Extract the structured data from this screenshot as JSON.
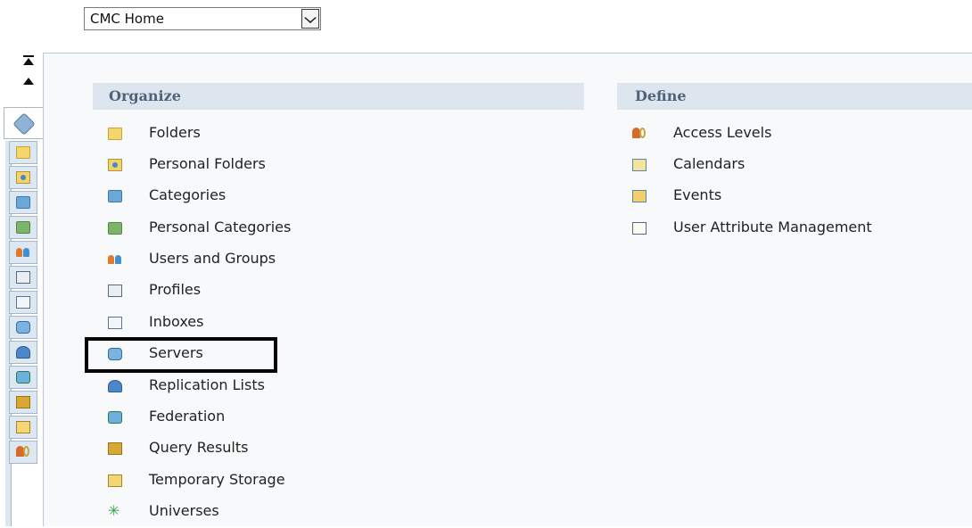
{
  "nav": {
    "selected": "CMC Home"
  },
  "organize": {
    "title": "Organize",
    "items": [
      {
        "label": "Folders",
        "icon": "folder-icon"
      },
      {
        "label": "Personal Folders",
        "icon": "personal-folder-icon"
      },
      {
        "label": "Categories",
        "icon": "categories-icon"
      },
      {
        "label": "Personal Categories",
        "icon": "personal-categories-icon"
      },
      {
        "label": "Users and Groups",
        "icon": "users-groups-icon"
      },
      {
        "label": "Profiles",
        "icon": "profiles-icon"
      },
      {
        "label": "Inboxes",
        "icon": "inbox-icon"
      },
      {
        "label": "Servers",
        "icon": "servers-icon"
      },
      {
        "label": "Replication Lists",
        "icon": "replication-icon"
      },
      {
        "label": "Federation",
        "icon": "federation-icon"
      },
      {
        "label": "Query Results",
        "icon": "query-results-icon"
      },
      {
        "label": "Temporary Storage",
        "icon": "temporary-storage-icon"
      },
      {
        "label": "Universes",
        "icon": "universes-icon"
      }
    ]
  },
  "define": {
    "title": "Define",
    "items": [
      {
        "label": "Access Levels",
        "icon": "access-levels-icon"
      },
      {
        "label": "Calendars",
        "icon": "calendar-icon"
      },
      {
        "label": "Events",
        "icon": "events-icon"
      },
      {
        "label": "User Attribute Management",
        "icon": "user-attribute-icon"
      }
    ]
  },
  "toolbar_tabs": [
    "home-tab-icon",
    "folder-tab-icon",
    "personal-folder-tab-icon",
    "categories-tab-icon",
    "personal-categories-tab-icon",
    "users-tab-icon",
    "profiles-tab-icon",
    "inbox-tab-icon",
    "servers-tab-icon",
    "replication-tab-icon",
    "federation-tab-icon",
    "query-tab-icon",
    "temporary-storage-tab-icon",
    "access-levels-tab-icon"
  ],
  "colors": {
    "header_bg": "#dde5ee",
    "header_text": "#50627a",
    "panel_bg": "#f7f9fb",
    "highlight_border": "#050505"
  }
}
